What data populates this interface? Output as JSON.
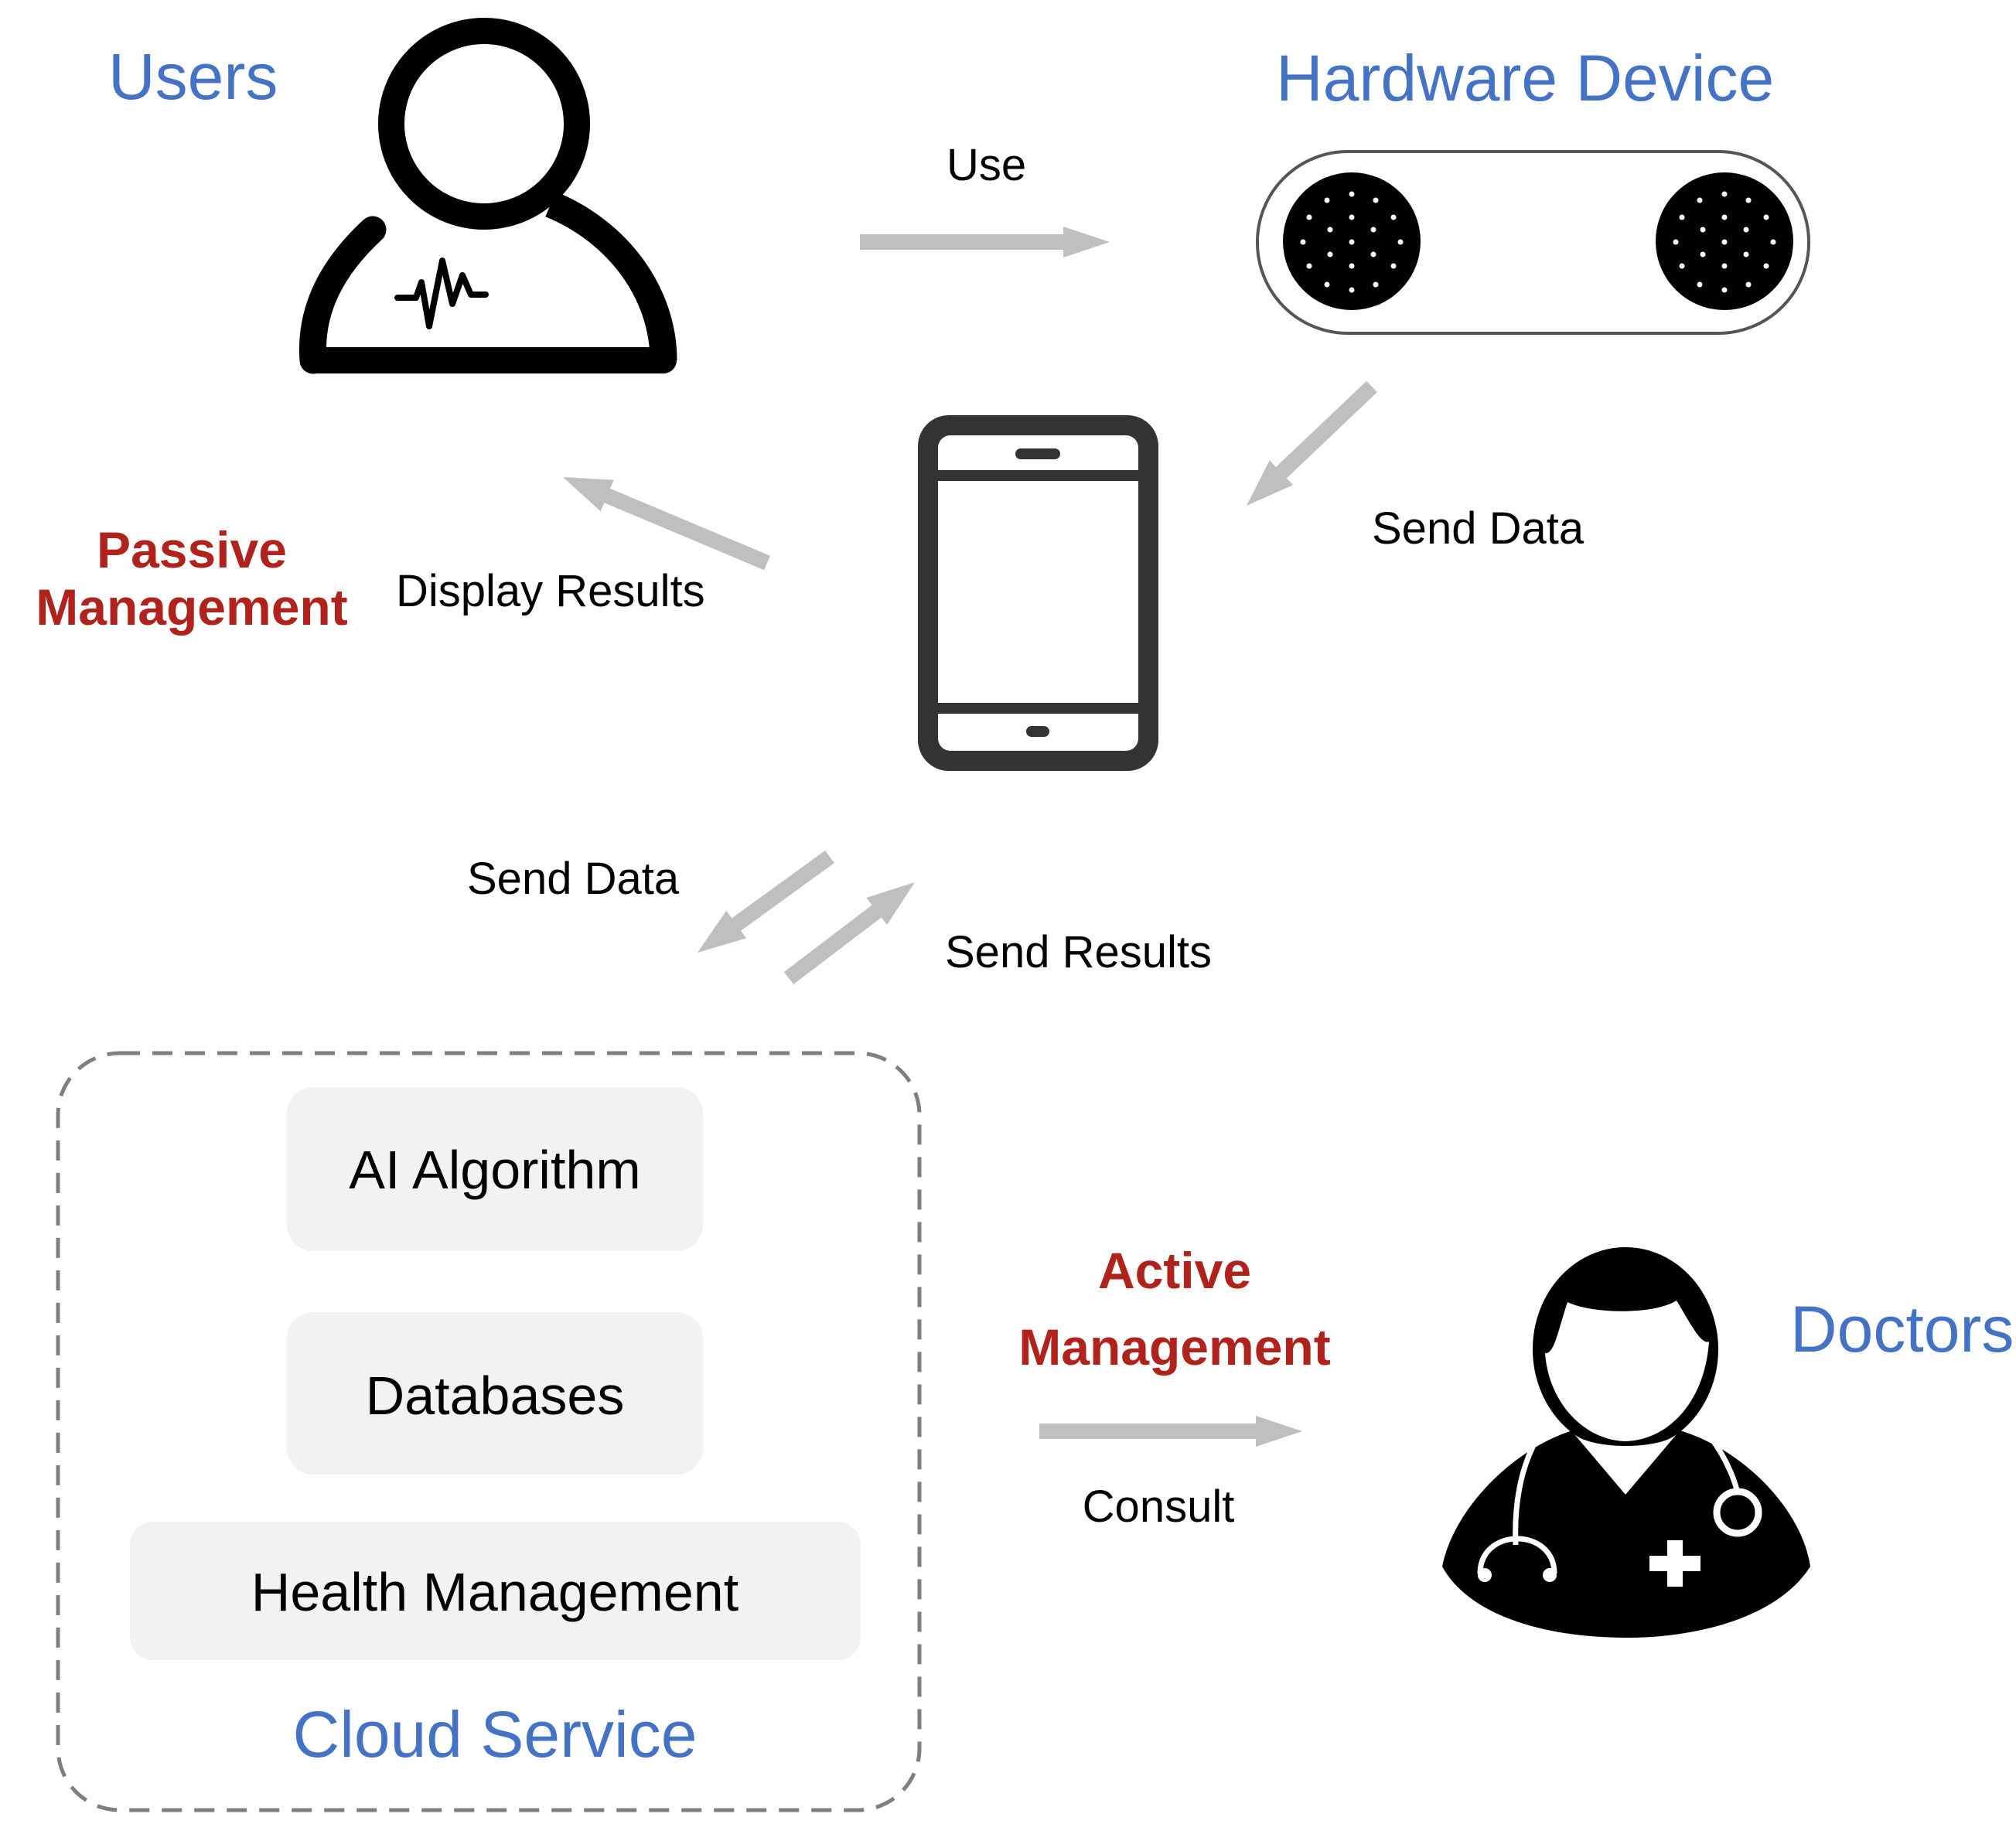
{
  "colors": {
    "entity_label": "#4472C4",
    "management_label": "#B0231C",
    "arrow": "#BFBFBF",
    "text": "#000000",
    "icon_dark": "#000000",
    "phone": "#333333",
    "module_fill": "#F2F2F2",
    "cloud_border": "#7F7F7F",
    "device_outline": "#555555"
  },
  "entities": {
    "users": {
      "label": "Users",
      "icon": "user-heartbeat-icon"
    },
    "hardware": {
      "label": "Hardware Device",
      "icon": "wearable-device-icon"
    },
    "phone": {
      "icon": "smartphone-icon"
    },
    "cloud": {
      "label": "Cloud Service",
      "icon": "none"
    },
    "doctors": {
      "label": "Doctors",
      "icon": "doctor-stethoscope-icon"
    }
  },
  "cloud_modules": [
    {
      "label": "AI Algorithm"
    },
    {
      "label": "Databases"
    },
    {
      "label": "Health Management"
    }
  ],
  "flows": [
    {
      "id": "use",
      "from": "Users",
      "to": "Hardware Device",
      "label": "Use"
    },
    {
      "id": "send-data-device",
      "from": "Hardware Device",
      "to": "Phone",
      "label": "Send Data"
    },
    {
      "id": "display-results",
      "from": "Phone",
      "to": "Users",
      "label": "Display Results"
    },
    {
      "id": "send-data-cloud",
      "from": "Phone",
      "to": "Cloud Service",
      "label": "Send Data"
    },
    {
      "id": "send-results",
      "from": "Cloud Service",
      "to": "Phone",
      "label": "Send Results"
    },
    {
      "id": "consult",
      "from": "Cloud Service",
      "to": "Doctors",
      "label": "Consult"
    }
  ],
  "management": {
    "passive": {
      "line1": "Passive",
      "line2": "Management"
    },
    "active": {
      "line1": "Active",
      "line2": "Management"
    }
  }
}
